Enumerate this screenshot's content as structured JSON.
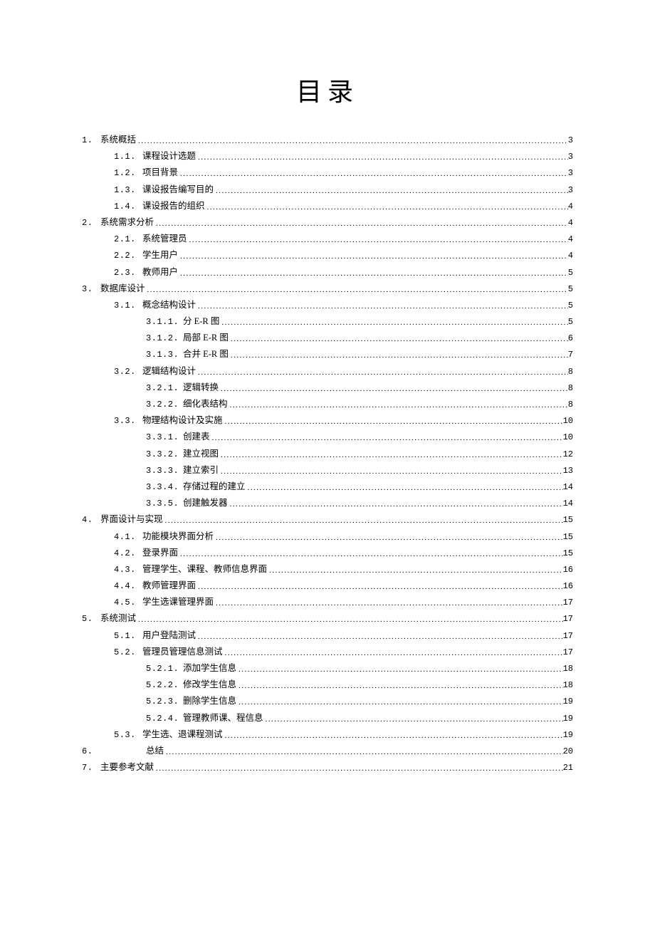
{
  "title": "目录",
  "entries": [
    {
      "level": 1,
      "num": "1.",
      "text": "系统概括",
      "page": "3"
    },
    {
      "level": 2,
      "num": "1.1.",
      "text": "课程设计选题",
      "page": "3"
    },
    {
      "level": 2,
      "num": "1.2.",
      "text": "项目背景",
      "page": "3"
    },
    {
      "level": 2,
      "num": "1.3.",
      "text": "课设报告编写目的 ",
      "page": " 3"
    },
    {
      "level": 2,
      "num": "1.4.",
      "text": "课设报告的组织",
      "page": "4"
    },
    {
      "level": 1,
      "num": "2.",
      "text": "系统需求分析",
      "page": "4"
    },
    {
      "level": 2,
      "num": "2.1.",
      "text": "系统管理员",
      "page": "4"
    },
    {
      "level": 2,
      "num": "2.2.",
      "text": "学生用户",
      "page": "4"
    },
    {
      "level": 2,
      "num": "2.3.",
      "text": "教师用户 ",
      "page": "5"
    },
    {
      "level": 1,
      "num": "3.",
      "text": "数据库设计",
      "page": "5"
    },
    {
      "level": 2,
      "num": "3.1.",
      "text": "概念结构设计 ",
      "page": "5"
    },
    {
      "level": 3,
      "num": "3.1.1.",
      "text": "分 E-R 图",
      "page": "5"
    },
    {
      "level": 3,
      "num": "3.1.2.",
      "text": " 局部 E-R 图",
      "page": "6"
    },
    {
      "level": 3,
      "num": "3.1.3.",
      "text": "合并 E-R 图",
      "page": "7"
    },
    {
      "level": 2,
      "num": "3.2.",
      "text": "逻辑结构设计",
      "page": "8"
    },
    {
      "level": 3,
      "num": "3.2.1.",
      "text": "逻辑转换 ",
      "page": "8"
    },
    {
      "level": 3,
      "num": "3.2.2.",
      "text": "细化表结构 ",
      "page": "8"
    },
    {
      "level": 2,
      "num": "3.3.",
      "text": "物理结构设计及实施 ",
      "page": "10"
    },
    {
      "level": 3,
      "num": "3.3.1.",
      "text": "创建表",
      "page": "10"
    },
    {
      "level": 3,
      "num": "3.3.2.",
      "text": "建立视图 ",
      "page": "12"
    },
    {
      "level": 3,
      "num": "3.3.3.",
      "text": "建立索引 ",
      "page": "13"
    },
    {
      "level": 3,
      "num": "3.3.4.",
      "text": "存储过程的建立",
      "page": "14"
    },
    {
      "level": 3,
      "num": "3.3.5.",
      "text": "创建触发器 ",
      "page": "14"
    },
    {
      "level": 1,
      "num": "4.",
      "text": "界面设计与实现",
      "page": "15"
    },
    {
      "level": 2,
      "num": "4.1.",
      "text": "功能模块界面分析 ",
      "page": "15"
    },
    {
      "level": 2,
      "num": "4.2.",
      "text": "登录界面",
      "page": "15"
    },
    {
      "level": 2,
      "num": "4.3.",
      "text": "管理学生、课程、教师信息界面 ",
      "page": " 16"
    },
    {
      "level": 2,
      "num": "4.4.",
      "text": "教师管理界面",
      "page": "16"
    },
    {
      "level": 2,
      "num": "4.5.",
      "text": "学生选课管理界面 ",
      "page": "17"
    },
    {
      "level": 1,
      "num": "5.",
      "text": "系统测试",
      "page": "17"
    },
    {
      "level": 2,
      "num": "5.1.",
      "text": "用户登陆测试 ",
      "page": "17"
    },
    {
      "level": 2,
      "num": "5.2.",
      "text": "管理员管理信息测试 ",
      "page": "17"
    },
    {
      "level": 3,
      "num": "5.2.1.",
      "text": "添加学生信息 ",
      "page": "18"
    },
    {
      "level": 3,
      "num": "5.2.2.",
      "text": "修改学生信息 ",
      "page": "18"
    },
    {
      "level": 3,
      "num": "5.2.3.",
      "text": "删除学生信息",
      "page": "19"
    },
    {
      "level": 3,
      "num": "5.2.4.",
      "text": "管理教师课、程信息 ",
      "page": "19"
    },
    {
      "level": 2,
      "num": "5.3.",
      "text": "学生选、退课程测试 ",
      "page": " 19"
    },
    {
      "level": 1,
      "num": "6.",
      "text": "总结",
      "page": "20",
      "special": true
    },
    {
      "level": 1,
      "num": "7.",
      "text": "主要参考文献",
      "page": "21"
    }
  ]
}
